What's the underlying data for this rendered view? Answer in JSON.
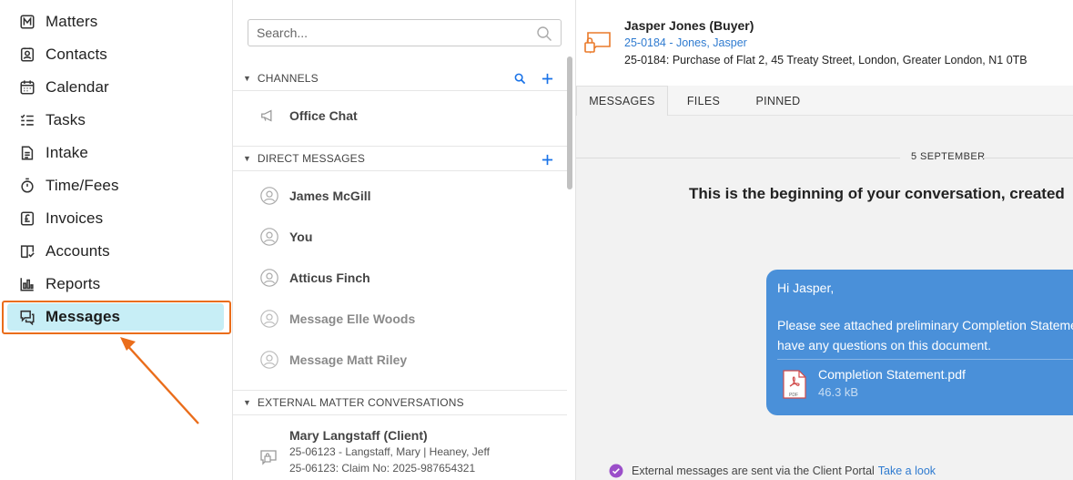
{
  "nav": {
    "items": [
      {
        "label": "Matters",
        "icon": "matters-icon"
      },
      {
        "label": "Contacts",
        "icon": "contacts-icon"
      },
      {
        "label": "Calendar",
        "icon": "calendar-icon"
      },
      {
        "label": "Tasks",
        "icon": "tasks-icon"
      },
      {
        "label": "Intake",
        "icon": "intake-icon"
      },
      {
        "label": "Time/Fees",
        "icon": "stopwatch-icon"
      },
      {
        "label": "Invoices",
        "icon": "pound-invoice-icon"
      },
      {
        "label": "Accounts",
        "icon": "accounts-icon"
      },
      {
        "label": "Reports",
        "icon": "reports-icon"
      },
      {
        "label": "Messages",
        "icon": "messages-icon",
        "active": true
      }
    ]
  },
  "channels_panel": {
    "search_placeholder": "Search...",
    "channels_title": "CHANNELS",
    "channels": [
      {
        "label": "Office Chat",
        "icon": "megaphone-icon"
      }
    ],
    "dm_title": "DIRECT MESSAGES",
    "direct_messages": [
      {
        "label": "James McGill",
        "muted": false
      },
      {
        "label": "You",
        "muted": false
      },
      {
        "label": "Atticus Finch",
        "muted": false
      },
      {
        "label": "Message Elle Woods",
        "muted": true
      },
      {
        "label": "Message Matt Riley",
        "muted": true
      }
    ],
    "external_title": "EXTERNAL MATTER CONVERSATIONS",
    "external_conversations": [
      {
        "title": "Mary Langstaff (Client)",
        "line1": "25-06123 - Langstaff, Mary | Heaney, Jeff",
        "line2": "25-06123: Claim No: 2025-987654321"
      }
    ]
  },
  "conversation": {
    "title": "Jasper Jones (Buyer)",
    "matter_link": "25-0184 - Jones, Jasper",
    "matter_description": "25-0184: Purchase of Flat 2, 45 Treaty Street, London, Greater London, N1 0TB",
    "tabs": [
      "MESSAGES",
      "FILES",
      "PINNED"
    ],
    "active_tab": "MESSAGES",
    "date_separator": "5 SEPTEMBER",
    "beginning_text": "This is the beginning of your conversation, created",
    "message": {
      "greeting": "Hi Jasper,",
      "line1": "Please see attached preliminary Completion Stateme",
      "line2": "have any questions on this document.",
      "attachment_name": "Completion Statement.pdf",
      "attachment_size": "46.3 kB",
      "bubble_color": "#4a90d9"
    },
    "external_note": "External messages are sent via the Client Portal",
    "external_link": "Take a look"
  },
  "colors": {
    "accent": "#1a73e8",
    "active_nav_bg": "#c7eef6",
    "highlight": "#ea6d1b"
  }
}
